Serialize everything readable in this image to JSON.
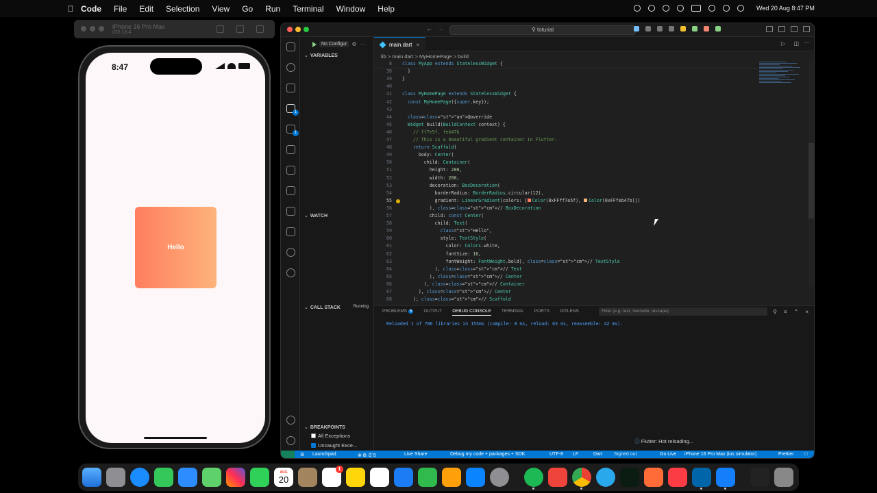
{
  "menubar": {
    "app": "Code",
    "items": [
      "File",
      "Edit",
      "Selection",
      "View",
      "Go",
      "Run",
      "Terminal",
      "Window",
      "Help"
    ],
    "clock": "Wed 20 Aug  8:47 PM"
  },
  "simulator": {
    "device_name": "iPhone 16 Pro Max",
    "os_version": "iOS 18.4",
    "time": "8:47",
    "box_text": "Hello",
    "gradient_colors": [
      "#ff7e5f",
      "#feb47b"
    ]
  },
  "vscode": {
    "search": "toturial",
    "run_config": "No Configur",
    "sections": {
      "variables": "VARIABLES",
      "watch": "WATCH",
      "call_stack": "CALL STACK",
      "call_stack_status": "Running",
      "breakpoints": "BREAKPOINTS"
    },
    "breakpoints": [
      {
        "label": "All Exceptions",
        "checked": false
      },
      {
        "label": "Uncaught Exce...",
        "checked": true
      }
    ],
    "tab": "main.dart",
    "breadcrumbs": [
      "lib",
      ">",
      "main.dart",
      ">",
      "MyHomePage",
      ">",
      "build"
    ],
    "sticky_line": {
      "num": "8",
      "text": "class MyApp extends StatelessWidget {"
    },
    "code_lines": [
      {
        "num": "38",
        "text": "  }"
      },
      {
        "num": "39",
        "text": "}"
      },
      {
        "num": "40",
        "text": ""
      },
      {
        "num": "41",
        "text": "class MyHomePage extends StatelessWidget {"
      },
      {
        "num": "42",
        "text": "  const MyHomePage({super.key});"
      },
      {
        "num": "43",
        "text": ""
      },
      {
        "num": "44",
        "text": "  @override"
      },
      {
        "num": "45",
        "text": "  Widget build(BuildContext context) {"
      },
      {
        "num": "46",
        "text": "    // ff7e5f, feb47b"
      },
      {
        "num": "47",
        "text": "    // This is a beautiful gradient container in Flutter."
      },
      {
        "num": "48",
        "text": "    return Scaffold("
      },
      {
        "num": "49",
        "text": "      body: Center("
      },
      {
        "num": "50",
        "text": "        child: Container("
      },
      {
        "num": "51",
        "text": "          height: 200,"
      },
      {
        "num": "52",
        "text": "          width: 200,"
      },
      {
        "num": "53",
        "text": "          decoration: BoxDecoration("
      },
      {
        "num": "54",
        "text": "            borderRadius: BorderRadius.circular(12),"
      },
      {
        "num": "55",
        "text": "            gradient: LinearGradient(colors: [Color(0xFFff7e5f), Color(0xFFfeb47b)])"
      },
      {
        "num": "56",
        "text": "          ), // BoxDecoration"
      },
      {
        "num": "57",
        "text": "          child: const Center("
      },
      {
        "num": "58",
        "text": "            child: Text("
      },
      {
        "num": "59",
        "text": "              \"Hello\","
      },
      {
        "num": "60",
        "text": "              style: TextStyle("
      },
      {
        "num": "61",
        "text": "                color: Colors.white,"
      },
      {
        "num": "62",
        "text": "                fontSize: 16,"
      },
      {
        "num": "63",
        "text": "                fontWeight: FontWeight.bold), // TextStyle"
      },
      {
        "num": "64",
        "text": "            ), // Text"
      },
      {
        "num": "65",
        "text": "          ), // Center"
      },
      {
        "num": "66",
        "text": "        ), // Container"
      },
      {
        "num": "67",
        "text": "      ), // Center"
      },
      {
        "num": "68",
        "text": "    ); // Scaffold"
      }
    ],
    "panel_tabs": [
      "PROBLEMS",
      "OUTPUT",
      "DEBUG CONSOLE",
      "TERMINAL",
      "PORTS",
      "GITLENS"
    ],
    "problems_count": "5",
    "filter_placeholder": "Filter (e.g. text, !exclude, \\escape)",
    "console_output": "Reloaded 1 of 706 libraries in 155ms (compile: 8 ms, reload: 63 ms, reassemble: 42 ms).",
    "notification": "Flutter: Hot reloading...",
    "status": {
      "launchpad": "Launchpad",
      "errors": "0",
      "warnings": "0",
      "infos": "5",
      "live_share": "Live Share",
      "debug_mode": "Debug my code + packages + SDK",
      "encoding": "UTF-8",
      "eol": "LF",
      "language": "Dart",
      "account": "Signed out",
      "go_live": "Go Live",
      "device": "iPhone 16 Pro Max (ios simulator)",
      "prettier": "Prettier"
    }
  },
  "dock": {
    "calendar_month": "AUG",
    "calendar_day": "20",
    "reminders_badge": "1",
    "apps": [
      "finder-icon",
      "launchpad-icon",
      "safari-icon",
      "messages-icon",
      "mail-icon",
      "maps-icon",
      "photos-icon",
      "facetime-icon",
      "calendar-icon",
      "notes-brown-icon",
      "reminders-icon",
      "notes-icon",
      "freeform-icon",
      "files-icon",
      "numbers-icon",
      "pages-icon",
      "app-store-icon",
      "system-settings-icon",
      "spotify-icon",
      "anydesk-icon",
      "chrome-icon",
      "telegram-icon",
      "mongodb-icon",
      "postman-icon",
      "music-icon",
      "vscode-icon",
      "xcode-icon",
      "downloads-icon",
      "trash-icon"
    ]
  }
}
